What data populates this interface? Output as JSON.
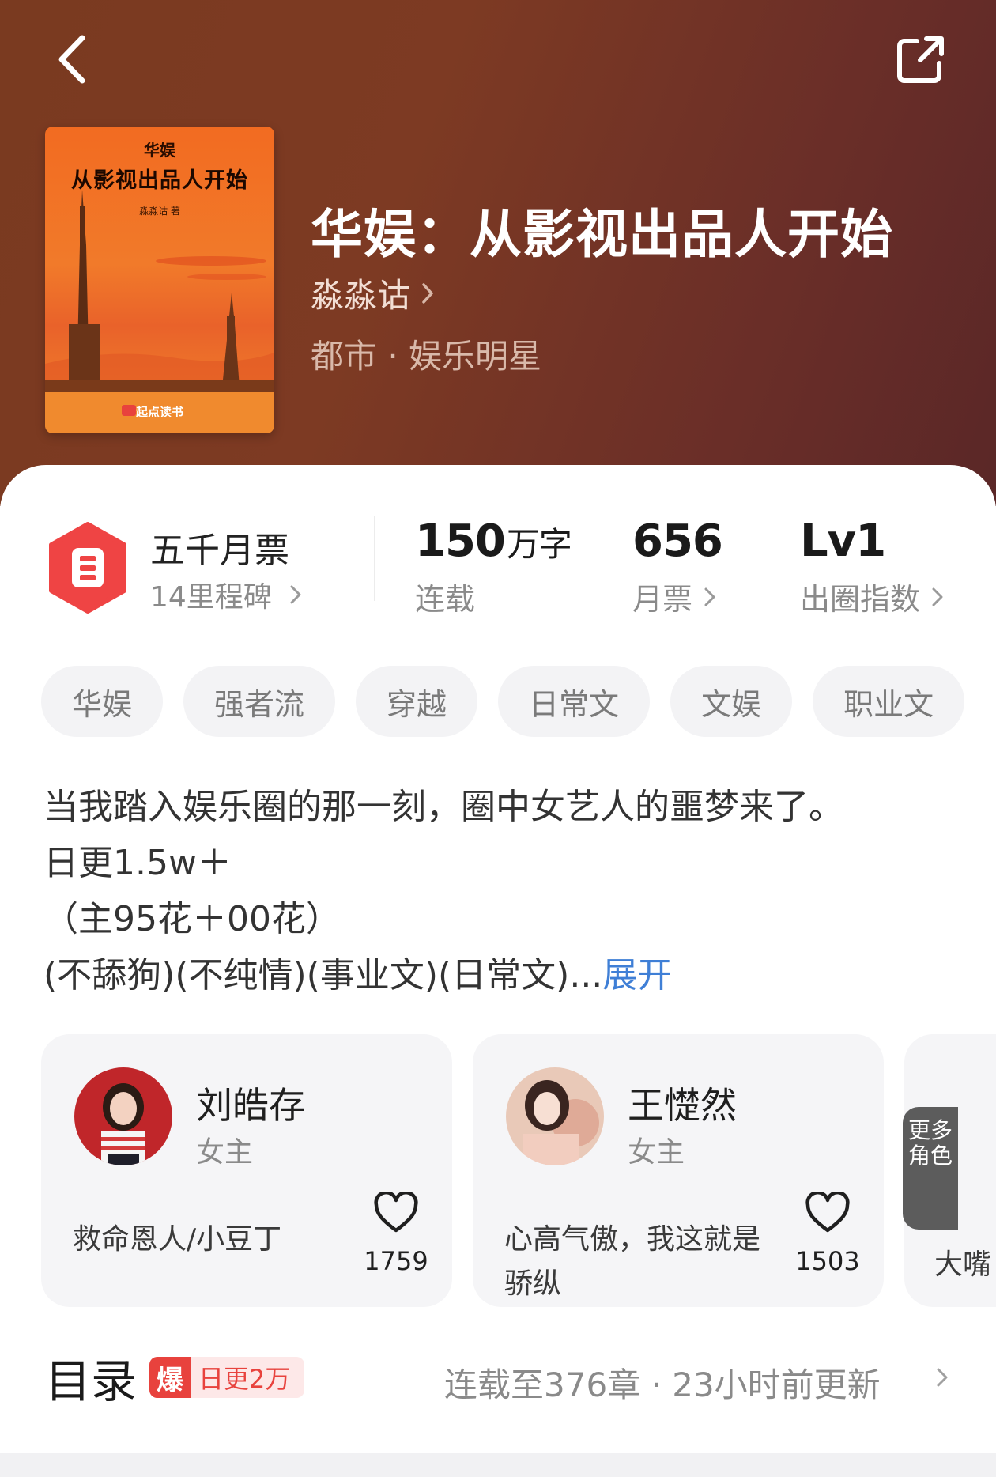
{
  "book": {
    "title": "华娱：从影视出品人开始",
    "author": "淼淼诂",
    "genre": "都市 · 娱乐明星",
    "cover": {
      "sub_title": "华娱",
      "main_title": "从影视出品人开始",
      "author_line": "淼淼诂 著",
      "brand": "起点读书"
    }
  },
  "monthly_ticket": {
    "title": "五千月票",
    "milestones": "14里程碑"
  },
  "stats": {
    "words_value": "150",
    "words_unit": "万字",
    "words_label": "连载",
    "tickets_value": "656",
    "tickets_label": "月票",
    "level_value": "Lv1",
    "level_label": "出圈指数"
  },
  "tags": [
    "华娱",
    "强者流",
    "穿越",
    "日常文",
    "文娱",
    "职业文"
  ],
  "description": {
    "line1": "当我踏入娱乐圈的那一刻，圈中女艺人的噩梦来了。",
    "line2": "日更1.5w＋",
    "line3": "（主95花＋00花）",
    "line4": "(不舔狗)(不纯情)(事业文)(日常文)...",
    "expand": "展开"
  },
  "characters": [
    {
      "name": "刘皓存",
      "role": "女主",
      "desc": "救命恩人/小豆丁",
      "likes": "1759"
    },
    {
      "name": "王憷然",
      "role": "女主",
      "desc": "心高气傲，我这就是骄纵",
      "likes": "1503"
    }
  ],
  "more_roles": "更多角色",
  "peek_desc": "大嘴",
  "catalog": {
    "title": "目录",
    "hot_icon": "爆",
    "hot_text": "日更2万",
    "status": "连载至376章 · 23小时前更新"
  },
  "colors": {
    "header_bg": "#7a3a20",
    "accent_red": "#e8423d",
    "link_blue": "#3f7fd6"
  },
  "icons": {
    "back": "chevron-left-icon",
    "share": "share-icon",
    "badge": "monthly-ticket-hexagon-icon",
    "like": "heart-icon"
  }
}
